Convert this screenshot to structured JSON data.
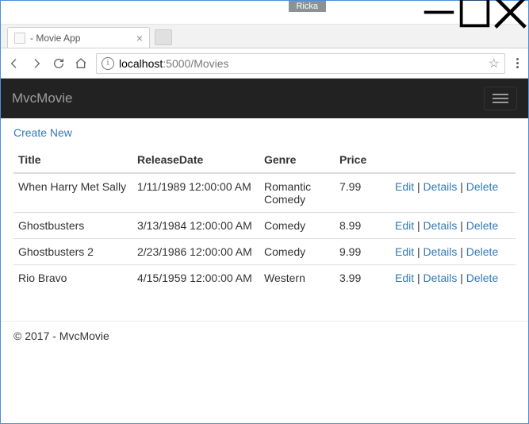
{
  "window": {
    "user_tag": "Ricka"
  },
  "browser": {
    "tab_title": " - Movie App",
    "url_host": "localhost",
    "url_port": ":5000",
    "url_path": "/Movies"
  },
  "navbar": {
    "brand": "MvcMovie"
  },
  "page": {
    "create_link": "Create New",
    "columns": {
      "title": "Title",
      "releaseDate": "ReleaseDate",
      "genre": "Genre",
      "price": "Price"
    },
    "actions": {
      "edit": "Edit",
      "details": "Details",
      "delete": "Delete"
    },
    "rows": [
      {
        "title": "When Harry Met Sally",
        "releaseDate": "1/11/1989 12:00:00 AM",
        "genre": "Romantic Comedy",
        "price": "7.99"
      },
      {
        "title": "Ghostbusters",
        "releaseDate": "3/13/1984 12:00:00 AM",
        "genre": "Comedy",
        "price": "8.99"
      },
      {
        "title": "Ghostbusters 2",
        "releaseDate": "2/23/1986 12:00:00 AM",
        "genre": "Comedy",
        "price": "9.99"
      },
      {
        "title": "Rio Bravo",
        "releaseDate": "4/15/1959 12:00:00 AM",
        "genre": "Western",
        "price": "3.99"
      }
    ]
  },
  "footer": {
    "text": "© 2017 - MvcMovie"
  }
}
